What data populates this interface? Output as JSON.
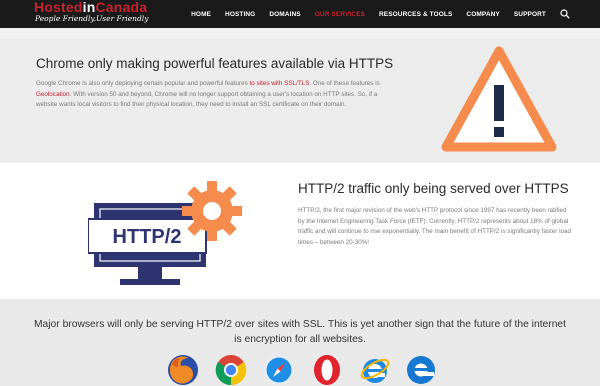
{
  "nav": {
    "logo_part1": "Hosted",
    "logo_part2": "in",
    "logo_part3": "Canada",
    "tagline": "People Friendly.User Friendly",
    "items": [
      {
        "label": "HOME",
        "active": false
      },
      {
        "label": "HOSTING",
        "active": false
      },
      {
        "label": "DOMAINS",
        "active": false
      },
      {
        "label": "OUR SERVICES",
        "active": true
      },
      {
        "label": "RESOURCES & TOOLS",
        "active": false
      },
      {
        "label": "COMPANY",
        "active": false
      },
      {
        "label": "SUPPORT",
        "active": false
      }
    ],
    "search_icon": "search-icon"
  },
  "section1": {
    "title": "Chrome only making powerful features available via HTTPS",
    "body_1": "Google Chrome is also only deploying certain popular and powerful features ",
    "link_1": "to sites with SSL/TLS",
    "body_2": ". One of these features is ",
    "link_2": "Geolocation",
    "body_3": ". With version 50 and beyond, Chrome will no longer support obtaining a user's location on HTTP sites. So, if a website wants local visitors to find their physical location, they need to install an SSL certificate on their domain.",
    "icon": "warning-icon"
  },
  "section2": {
    "title": "HTTP/2 traffic only being served over HTTPS",
    "body": "HTTP/2, the first major revision of the web's HTTP protocol since 1997 has recently been ratified by the Internet Engineering Task Force (IETF). Currently, HTTP/2 represents about 18% of global traffic and will continue to rise exponentially. The main benefit of HTTP/2 is significantly faster load times – between 20-30%!",
    "illustration_label": "HTTP/2",
    "icon": "monitor-gear-icon"
  },
  "section3": {
    "text": "Major browsers will only be serving HTTP/2 over sites with SSL. This is yet another sign that the future of the internet is encryption for all websites.",
    "browsers": [
      "firefox-icon",
      "chrome-icon",
      "safari-icon",
      "opera-icon",
      "ie-icon",
      "edge-icon"
    ]
  },
  "colors": {
    "brand_red": "#c4232f",
    "warning_orange": "#f58b4c",
    "monitor_navy": "#2e3470",
    "gear_orange": "#f58b4c"
  }
}
